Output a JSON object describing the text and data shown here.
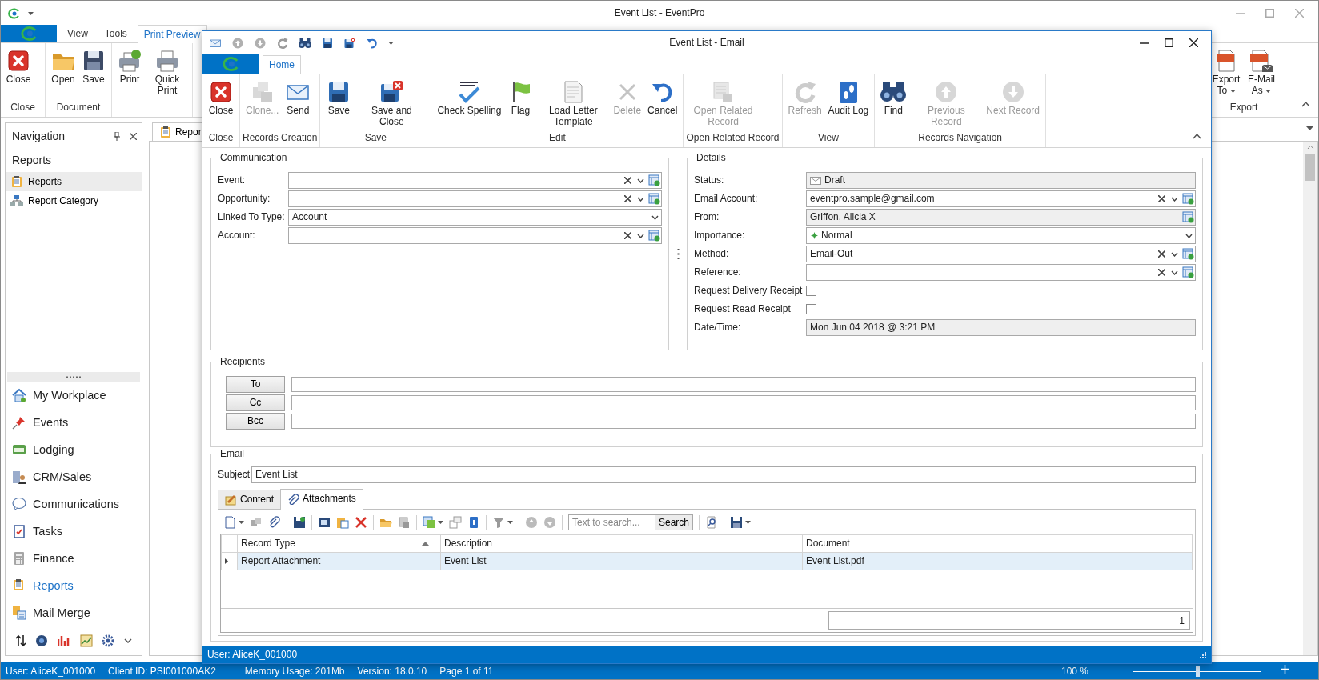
{
  "main_window": {
    "title": "Event List - EventPro",
    "ribbon_tabs": [
      {
        "label": "View",
        "selected": false
      },
      {
        "label": "Tools",
        "selected": false
      },
      {
        "label": "Print Preview",
        "selected": true
      }
    ],
    "ribbon_groups": [
      {
        "label": "Close",
        "buttons": [
          {
            "label": "Close"
          }
        ]
      },
      {
        "label": "Document",
        "buttons": [
          {
            "label": "Open"
          },
          {
            "label": "Save"
          }
        ]
      },
      {
        "buttons": [
          {
            "label": "Print"
          },
          {
            "label": "Quick Print"
          }
        ]
      }
    ],
    "export_group": {
      "label": "Export",
      "buttons": [
        {
          "label": "Export To",
          "dropdown": true
        },
        {
          "label": "E-Mail As",
          "dropdown": true
        }
      ]
    },
    "document_tab": "Repor"
  },
  "navigation": {
    "title": "Navigation",
    "heading": "Reports",
    "items": [
      {
        "label": "Reports",
        "selected": true
      },
      {
        "label": "Report Category",
        "selected": false
      }
    ],
    "modules": [
      {
        "label": "My Workplace",
        "selected": false
      },
      {
        "label": "Events",
        "selected": false
      },
      {
        "label": "Lodging",
        "selected": false
      },
      {
        "label": "CRM/Sales",
        "selected": false
      },
      {
        "label": "Communications",
        "selected": false
      },
      {
        "label": "Tasks",
        "selected": false
      },
      {
        "label": "Finance",
        "selected": false
      },
      {
        "label": "Reports",
        "selected": true
      },
      {
        "label": "Mail Merge",
        "selected": false
      }
    ]
  },
  "status_bar": {
    "items": [
      "User: AliceK_001000",
      "Client ID: PSI001000AK2",
      "Memory Usage: 201Mb",
      "Version: 18.0.10",
      "Page 1 of 11"
    ],
    "zoom": {
      "reading": "100 %",
      "level": 0.5
    }
  },
  "dialog": {
    "title": "Event List - Email",
    "tabs": [
      {
        "label": "Home",
        "selected": true
      }
    ],
    "ribbon_groups": [
      {
        "label": "Close",
        "buttons": [
          {
            "label": "Close",
            "disabled": false
          }
        ]
      },
      {
        "label": "Records Creation",
        "buttons": [
          {
            "label": "Clone...",
            "disabled": true
          },
          {
            "label": "Send",
            "disabled": false
          }
        ]
      },
      {
        "label": "Save",
        "buttons": [
          {
            "label": "Save",
            "disabled": false
          },
          {
            "label": "Save and Close",
            "disabled": false
          }
        ]
      },
      {
        "label": "Edit",
        "buttons": [
          {
            "label": "Check Spelling",
            "disabled": false
          },
          {
            "label": "Flag",
            "disabled": false
          },
          {
            "label": "Load Letter Template",
            "disabled": false
          },
          {
            "label": "Delete",
            "disabled": true
          },
          {
            "label": "Cancel",
            "disabled": false
          }
        ]
      },
      {
        "label": "Open Related Record",
        "buttons": [
          {
            "label": "Open Related Record",
            "disabled": true
          }
        ]
      },
      {
        "label": "View",
        "buttons": [
          {
            "label": "Refresh",
            "disabled": true
          },
          {
            "label": "Audit Log",
            "disabled": false
          }
        ]
      },
      {
        "label": "Records Navigation",
        "buttons": [
          {
            "label": "Find",
            "disabled": false
          },
          {
            "label": "Previous Record",
            "disabled": true
          },
          {
            "label": "Next Record",
            "disabled": true
          }
        ]
      }
    ],
    "communication": {
      "title": "Communication",
      "fields": [
        {
          "label": "Event:",
          "kind": "lookup"
        },
        {
          "label": "Opportunity:",
          "kind": "lookup"
        },
        {
          "label": "Linked To Type:",
          "kind": "dropdown",
          "value": "Account"
        },
        {
          "label": "Account:",
          "kind": "lookup"
        }
      ]
    },
    "details": {
      "title": "Details",
      "fields": [
        {
          "label": "Status:",
          "kind": "status",
          "value": "Draft"
        },
        {
          "label": "Email Account:",
          "kind": "lookup",
          "value": "eventpro.sample@gmail.com"
        },
        {
          "label": "From:",
          "kind": "picker",
          "value": "Griffon, Alicia X"
        },
        {
          "label": "Importance:",
          "kind": "importance",
          "value": "Normal"
        },
        {
          "label": "Method:",
          "kind": "lookup",
          "value": "Email-Out"
        },
        {
          "label": "Reference:",
          "kind": "lookup"
        },
        {
          "label": "Request Delivery Receipt",
          "kind": "checkbox",
          "checked": false
        },
        {
          "label": "Request Read Receipt",
          "kind": "checkbox",
          "checked": false
        },
        {
          "label": "Date/Time:",
          "kind": "readonly",
          "value": "Mon Jun 04 2018 @ 3:21 PM"
        }
      ]
    },
    "recipients": {
      "title": "Recipients",
      "buttons": [
        "To",
        "Cc",
        "Bcc"
      ]
    },
    "email": {
      "title": "Email",
      "subject_label": "Subject:",
      "subject": "Event List",
      "tabs": [
        {
          "label": "Content",
          "selected": false
        },
        {
          "label": "Attachments",
          "selected": true
        }
      ],
      "search": {
        "placeholder": "Text to search...",
        "button": "Search"
      },
      "table": {
        "columns": [
          {
            "label": "Record Type",
            "sorted": true
          },
          {
            "label": "Description",
            "sorted": false
          },
          {
            "label": "Document",
            "sorted": false
          }
        ],
        "rows": [
          {
            "cells": [
              "Report Attachment",
              "Event List",
              "Event List.pdf"
            ],
            "selected": true
          }
        ],
        "footer": "1"
      }
    },
    "status_bar": "User: AliceK_001000"
  }
}
